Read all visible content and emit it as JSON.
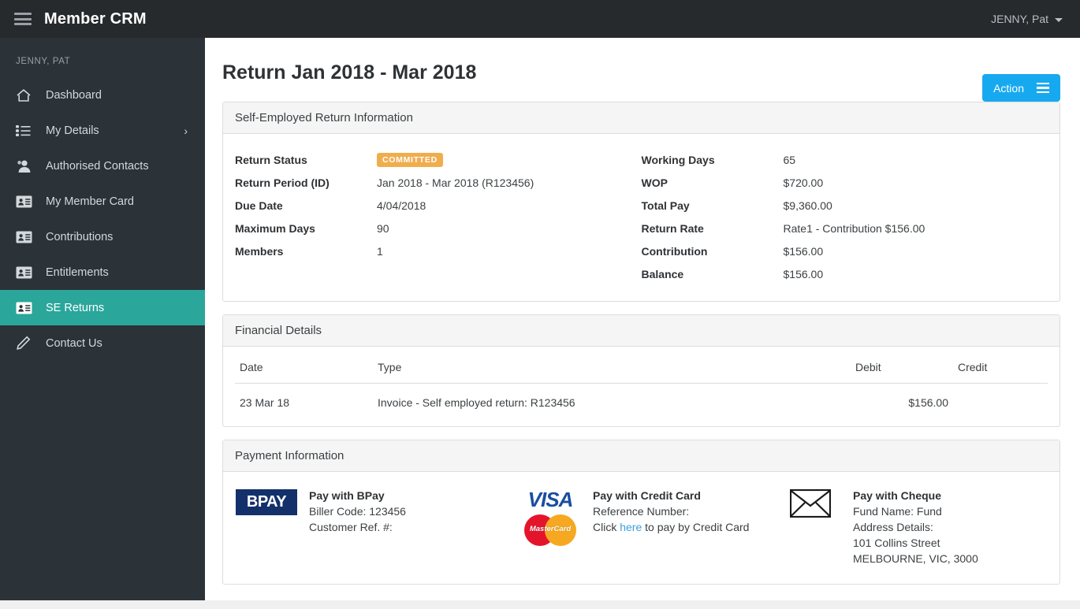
{
  "topbar": {
    "menu_icon": "hamburger-icon",
    "brand": "Member CRM",
    "user": "JENNY, Pat",
    "caret_icon": "chevron-down-icon"
  },
  "sidebar": {
    "user_label": "JENNY, PAT",
    "items": [
      {
        "label": "Dashboard",
        "icon": "home-icon",
        "active": false,
        "chevron": ""
      },
      {
        "label": "My Details",
        "icon": "list-icon",
        "active": false,
        "chevron": "›"
      },
      {
        "label": "Authorised Contacts",
        "icon": "person-icon",
        "active": false,
        "chevron": ""
      },
      {
        "label": "My Member Card",
        "icon": "id-card-icon",
        "active": false,
        "chevron": ""
      },
      {
        "label": "Contributions",
        "icon": "id-card-icon",
        "active": false,
        "chevron": ""
      },
      {
        "label": "Entitlements",
        "icon": "id-card-icon",
        "active": false,
        "chevron": ""
      },
      {
        "label": "SE Returns",
        "icon": "id-card-icon",
        "active": true,
        "chevron": ""
      },
      {
        "label": "Contact Us",
        "icon": "pencil-icon",
        "active": false,
        "chevron": ""
      }
    ]
  },
  "main": {
    "page_title": "Return Jan 2018 - Mar 2018",
    "action_button": "Action"
  },
  "return_info": {
    "panel_title": "Self-Employed Return Information",
    "left": [
      {
        "label": "Return Status",
        "value": "COMMITTED",
        "is_badge": true
      },
      {
        "label": "Return Period (ID)",
        "value": "Jan 2018 - Mar 2018 (R123456)"
      },
      {
        "label": "Due Date",
        "value": "4/04/2018"
      },
      {
        "label": "Maximum Days",
        "value": "90"
      },
      {
        "label": "Members",
        "value": "1"
      }
    ],
    "right": [
      {
        "label": "Working Days",
        "value": "65"
      },
      {
        "label": "WOP",
        "value": "$720.00"
      },
      {
        "label": "Total Pay",
        "value": "$9,360.00"
      },
      {
        "label": "Return Rate",
        "value": "Rate1 - Contribution $156.00"
      },
      {
        "label": "Contribution",
        "value": "$156.00"
      },
      {
        "label": "Balance",
        "value": "$156.00"
      }
    ]
  },
  "financial_details": {
    "panel_title": "Financial Details",
    "columns": [
      "Date",
      "Type",
      "Debit",
      "Credit"
    ],
    "rows": [
      {
        "date": "23 Mar 18",
        "type": "Invoice - Self employed return: R123456",
        "debit": "$156.00",
        "credit": ""
      }
    ]
  },
  "payment_information": {
    "panel_title": "Payment Information",
    "bpay": {
      "logo_text": "BPAY",
      "logo_icon": "bpay-logo",
      "title": "Pay with BPay",
      "line1": "Biller Code: 123456",
      "line2": "Customer Ref. #:"
    },
    "credit_card": {
      "visa_text": "VISA",
      "visa_icon": "visa-logo",
      "mastercard_text": "MasterCard",
      "mastercard_icon": "mastercard-logo",
      "title": "Pay with Credit Card",
      "line1": "Reference Number:",
      "click_prefix": "Click ",
      "link_text": "here",
      "click_suffix": " to pay by Credit Card"
    },
    "cheque": {
      "icon": "envelope-icon",
      "title": "Pay with Cheque",
      "line1": "Fund Name: Fund",
      "line2": "Address Details:",
      "line3": "101 Collins Street",
      "line4": "MELBOURNE, VIC, 3000"
    }
  },
  "colors": {
    "topbar": "#262a2d",
    "sidebar": "#2b3238",
    "sidebar_active": "#2aa69b",
    "action_blue": "#17a9f0",
    "badge_orange": "#f0ad4e",
    "link_blue": "#3a9fe0",
    "bpay_navy": "#14306b",
    "visa_blue": "#1a4ea0",
    "mastercard_red": "#e4152b",
    "mastercard_orange": "#f6a821"
  }
}
